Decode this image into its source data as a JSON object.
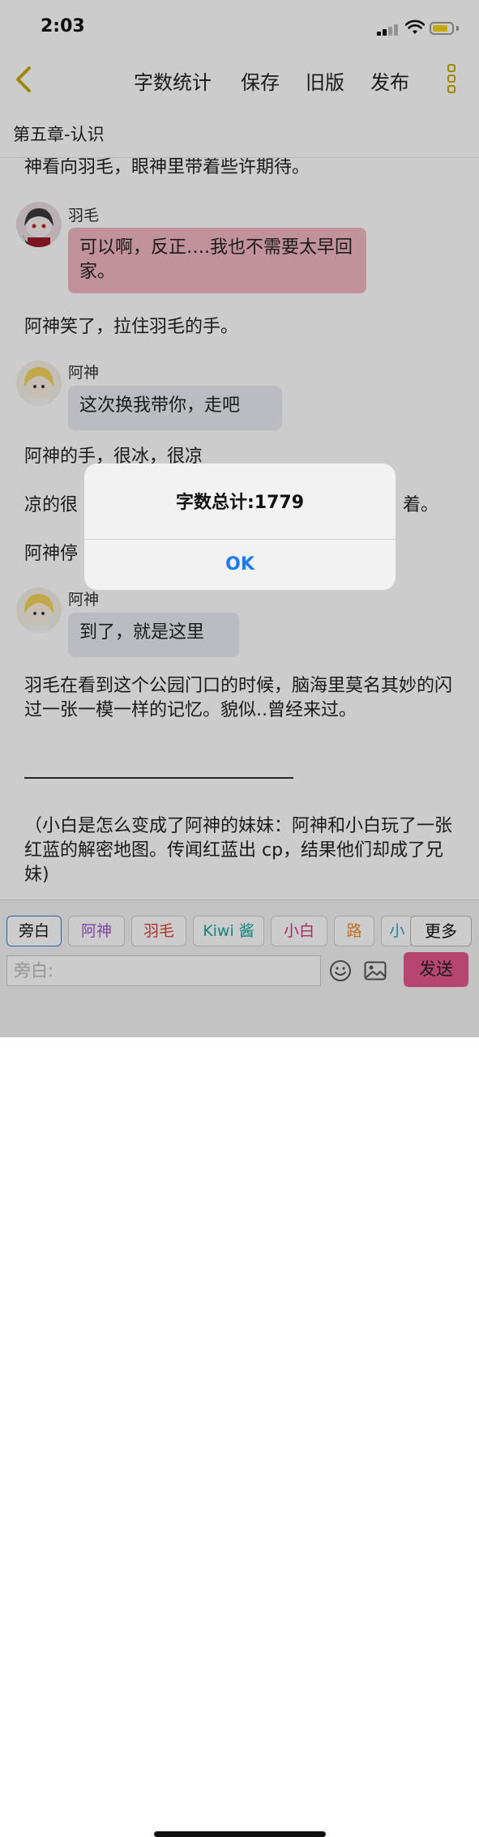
{
  "status": {
    "time": "2:03"
  },
  "nav": {
    "word_count": "字数统计",
    "save": "保存",
    "old_version": "旧版",
    "publish": "发布"
  },
  "chapter": {
    "title": "第五章-认识"
  },
  "content": {
    "line1": "神看向羽毛，眼神里带着些许期待。",
    "msg1": {
      "speaker": "羽毛",
      "text": "可以啊，反正….我也不需要太早回家。"
    },
    "line2": "阿神笑了，拉住羽毛的手。",
    "msg2": {
      "speaker": "阿神",
      "text": "这次换我带你，走吧"
    },
    "line3": "阿神的手，很冰，很凉",
    "line4_start": "凉的很",
    "line4_end": "着。",
    "line5_start": "阿神停",
    "msg3": {
      "speaker": "阿神",
      "text": "到了，就是这里"
    },
    "line6": "羽毛在看到这个公园门口的时候，脑海里莫名其妙的闪过一张一模一样的记忆。貌似..曾经来过。",
    "line7": "（小白是怎么变成了阿神的妹妹：阿神和小白玩了一张红蓝的解密地图。传闻红蓝出 cp，结果他们却成了兄妹)"
  },
  "toolbar": {
    "chips": [
      {
        "label": "旁白",
        "color": "#333333"
      },
      {
        "label": "阿神",
        "color": "#9b59d0"
      },
      {
        "label": "羽毛",
        "color": "#e0403a"
      },
      {
        "label": "Kiwi 酱",
        "color": "#1fa89a"
      },
      {
        "label": "小白",
        "color": "#d2327a"
      },
      {
        "label": "路",
        "color": "#f08a2e"
      },
      {
        "label": "小",
        "color": "#2a9fd6"
      }
    ],
    "more": "更多",
    "input_placeholder": "旁白:",
    "send": "发送"
  },
  "alert": {
    "title": "字数总计:1779",
    "ok": "OK"
  },
  "colors": {
    "accent_blue": "#1a7cf2",
    "send_pink": "#e4578b",
    "bubble_pink": "#f2b6c4",
    "bubble_gray": "#e9ecf3"
  }
}
